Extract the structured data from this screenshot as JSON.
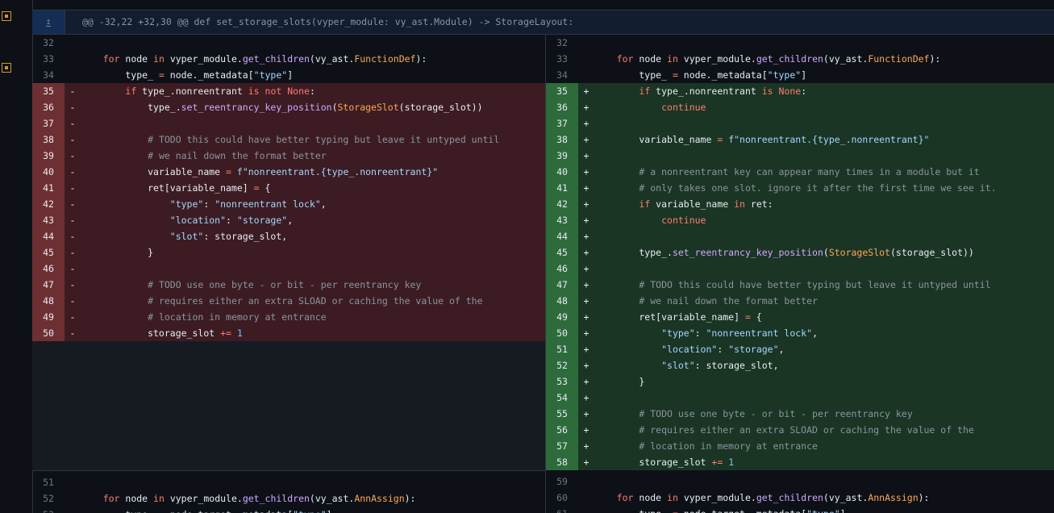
{
  "hunk_header": "@@ -32,22 +32,30 @@ def set_storage_slots(vyper_module: vy_ast.Module) -> StorageLayout:",
  "left": [
    {
      "n": "32",
      "t": "ctx",
      "code": ""
    },
    {
      "n": "33",
      "t": "ctx",
      "code": "    for node in vyper_module.get_children(vy_ast.FunctionDef):"
    },
    {
      "n": "34",
      "t": "ctx",
      "code": "        type_ = node._metadata[\"type\"]"
    },
    {
      "n": "35",
      "t": "del",
      "code": "        if type_.nonreentrant is not None:"
    },
    {
      "n": "36",
      "t": "del",
      "code": "            type_.set_reentrancy_key_position(StorageSlot(storage_slot))"
    },
    {
      "n": "37",
      "t": "del",
      "code": ""
    },
    {
      "n": "38",
      "t": "del",
      "code": "            # TODO this could have better typing but leave it untyped until"
    },
    {
      "n": "39",
      "t": "del",
      "code": "            # we nail down the format better"
    },
    {
      "n": "40",
      "t": "del",
      "code": "            variable_name = f\"nonreentrant.{type_.nonreentrant}\""
    },
    {
      "n": "41",
      "t": "del",
      "code": "            ret[variable_name] = {"
    },
    {
      "n": "42",
      "t": "del",
      "code": "                \"type\": \"nonreentrant lock\","
    },
    {
      "n": "43",
      "t": "del",
      "code": "                \"location\": \"storage\","
    },
    {
      "n": "44",
      "t": "del",
      "code": "                \"slot\": storage_slot,"
    },
    {
      "n": "45",
      "t": "del",
      "code": "            }"
    },
    {
      "n": "46",
      "t": "del",
      "code": ""
    },
    {
      "n": "47",
      "t": "del",
      "code": "            # TODO use one byte - or bit - per reentrancy key"
    },
    {
      "n": "48",
      "t": "del",
      "code": "            # requires either an extra SLOAD or caching the value of the"
    },
    {
      "n": "49",
      "t": "del",
      "code": "            # location in memory at entrance"
    },
    {
      "n": "50",
      "t": "del",
      "code": "            storage_slot += 1"
    }
  ],
  "left_tail": [
    {
      "n": "51",
      "t": "ctx",
      "code": ""
    },
    {
      "n": "52",
      "t": "ctx",
      "code": "    for node in vyper_module.get_children(vy_ast.AnnAssign):"
    },
    {
      "n": "53",
      "t": "ctx",
      "code": "        type_ = node.target._metadata[\"type\"]"
    }
  ],
  "right": [
    {
      "n": "32",
      "t": "ctx",
      "code": ""
    },
    {
      "n": "33",
      "t": "ctx",
      "code": "    for node in vyper_module.get_children(vy_ast.FunctionDef):"
    },
    {
      "n": "34",
      "t": "ctx",
      "code": "        type_ = node._metadata[\"type\"]"
    },
    {
      "n": "35",
      "t": "add",
      "code": "        if type_.nonreentrant is None:"
    },
    {
      "n": "36",
      "t": "add",
      "code": "            continue"
    },
    {
      "n": "37",
      "t": "add",
      "code": ""
    },
    {
      "n": "38",
      "t": "add",
      "code": "        variable_name = f\"nonreentrant.{type_.nonreentrant}\""
    },
    {
      "n": "39",
      "t": "add",
      "code": ""
    },
    {
      "n": "40",
      "t": "add",
      "code": "        # a nonreentrant key can appear many times in a module but it"
    },
    {
      "n": "41",
      "t": "add",
      "code": "        # only takes one slot. ignore it after the first time we see it."
    },
    {
      "n": "42",
      "t": "add",
      "code": "        if variable_name in ret:"
    },
    {
      "n": "43",
      "t": "add",
      "code": "            continue"
    },
    {
      "n": "44",
      "t": "add",
      "code": ""
    },
    {
      "n": "45",
      "t": "add",
      "code": "        type_.set_reentrancy_key_position(StorageSlot(storage_slot))"
    },
    {
      "n": "46",
      "t": "add",
      "code": ""
    },
    {
      "n": "47",
      "t": "add",
      "code": "        # TODO this could have better typing but leave it untyped until"
    },
    {
      "n": "48",
      "t": "add",
      "code": "        # we nail down the format better"
    },
    {
      "n": "49",
      "t": "add",
      "code": "        ret[variable_name] = {"
    },
    {
      "n": "50",
      "t": "add",
      "code": "            \"type\": \"nonreentrant lock\","
    },
    {
      "n": "51",
      "t": "add",
      "code": "            \"location\": \"storage\","
    },
    {
      "n": "52",
      "t": "add",
      "code": "            \"slot\": storage_slot,"
    },
    {
      "n": "53",
      "t": "add",
      "code": "        }"
    },
    {
      "n": "54",
      "t": "add",
      "code": ""
    },
    {
      "n": "55",
      "t": "add",
      "code": "        # TODO use one byte - or bit - per reentrancy key"
    },
    {
      "n": "56",
      "t": "add",
      "code": "        # requires either an extra SLOAD or caching the value of the"
    },
    {
      "n": "57",
      "t": "add",
      "code": "        # location in memory at entrance"
    },
    {
      "n": "58",
      "t": "add",
      "code": "        storage_slot += 1"
    }
  ],
  "right_tail": [
    {
      "n": "59",
      "t": "ctx",
      "code": ""
    },
    {
      "n": "60",
      "t": "ctx",
      "code": "    for node in vyper_module.get_children(vy_ast.AnnAssign):"
    },
    {
      "n": "61",
      "t": "ctx",
      "code": "        type_ = node.target._metadata[\"type\"]"
    }
  ],
  "markers": {
    "del": "-",
    "add": "+"
  },
  "icons": {
    "expand": "expand-up-icon",
    "file_marker": "square-dot-icon"
  },
  "colors": {
    "deleted_bg": "#3c1c22",
    "added_bg": "#1a3524",
    "highlight": "#e5534b"
  }
}
